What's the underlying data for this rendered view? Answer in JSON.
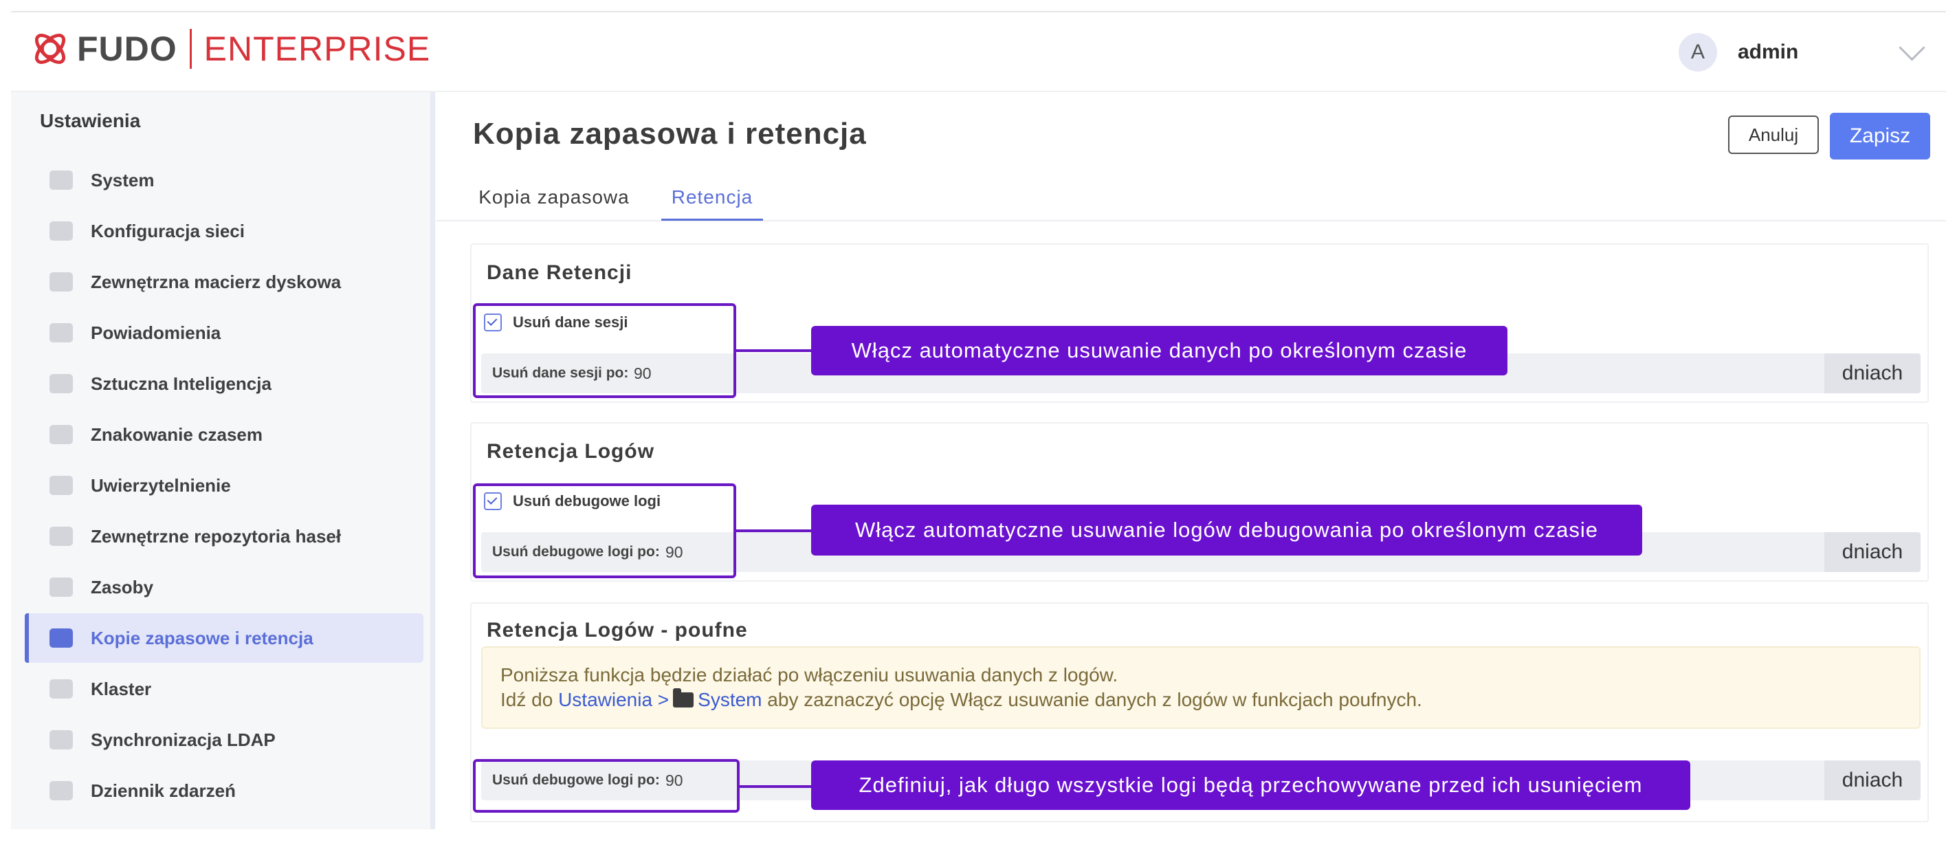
{
  "header": {
    "brand": "FUDO",
    "product": "ENTERPRISE",
    "avatar_initial": "A",
    "username": "admin"
  },
  "sidebar": {
    "title": "Ustawienia",
    "items": [
      {
        "label": "System",
        "icon": "folder-icon"
      },
      {
        "label": "Konfiguracja sieci",
        "icon": "cloud-icon"
      },
      {
        "label": "Zewnętrzna macierz dyskowa",
        "icon": "cubes-icon"
      },
      {
        "label": "Powiadomienia",
        "icon": "megaphone-icon"
      },
      {
        "label": "Sztuczna Inteligencja",
        "icon": "brain-icon"
      },
      {
        "label": "Znakowanie czasem",
        "icon": "stamp-icon"
      },
      {
        "label": "Uwierzytelnienie",
        "icon": "key-icon"
      },
      {
        "label": "Zewnętrzne repozytoria haseł",
        "icon": "vault-icon"
      },
      {
        "label": "Zasoby",
        "icon": "image-icon"
      },
      {
        "label": "Kopie zapasowe i retencja",
        "icon": "archive-icon"
      },
      {
        "label": "Klaster",
        "icon": "cluster-icon"
      },
      {
        "label": "Synchronizacja LDAP",
        "icon": "sync-icon"
      },
      {
        "label": "Dziennik zdarzeń",
        "icon": "calendar-icon"
      }
    ],
    "active_index": 9
  },
  "page": {
    "title": "Kopia zapasowa i retencja",
    "cancel_label": "Anuluj",
    "save_label": "Zapisz",
    "tabs": [
      "Kopia zapasowa",
      "Retencja"
    ],
    "active_tab": 1
  },
  "sections": [
    {
      "title": "Dane Retencji",
      "checkbox_label": "Usuń dane sesji",
      "checked": true,
      "field_label": "Usuń dane sesji po:",
      "field_value": "90",
      "unit": "dniach",
      "callout": "Włącz automatyczne usuwanie danych po określonym czasie"
    },
    {
      "title": "Retencja Logów",
      "checkbox_label": "Usuń debugowe logi",
      "checked": true,
      "field_label": "Usuń debugowe logi po:",
      "field_value": "90",
      "unit": "dniach",
      "callout": "Włącz automatyczne usuwanie logów debugowania po określonym czasie"
    },
    {
      "title": "Retencja Logów - poufne",
      "warning_line1": "Poniższa funkcja będzie działać po włączeniu usuwania danych z logów.",
      "warning_pre": "Idź do",
      "warning_link_settings": "Ustawienia >",
      "warning_link_system": "System",
      "warning_post": "aby zaznaczyć opcję Włącz usuwanie danych z logów w funkcjach poufnych.",
      "field_label": "Usuń debugowe logi po:",
      "field_value": "90",
      "unit": "dniach",
      "callout": "Zdefiniuj, jak długo wszystkie logi będą przechowywane przed ich usunięciem"
    }
  ],
  "colors": {
    "brand_red": "#d8333b",
    "accent_blue": "#5b7cf0",
    "annotation_purple": "#6a10cf"
  }
}
